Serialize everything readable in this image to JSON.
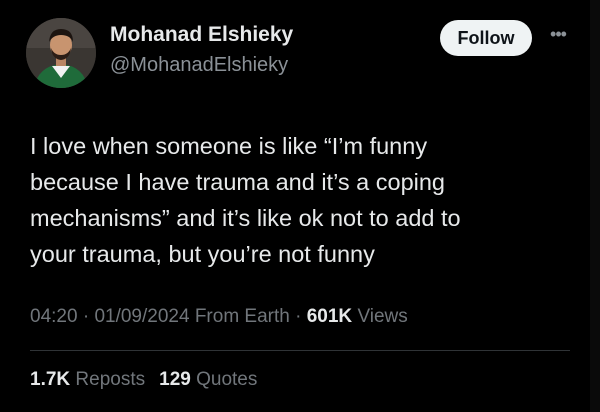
{
  "author": {
    "display_name": "Mohanad Elshieky",
    "handle": "@MohanadElshieky"
  },
  "actions": {
    "follow_label": "Follow",
    "more_icon": "more-horizontal-icon"
  },
  "tweet": {
    "text": "I love when someone is like “I’m funny\nbecause I have trauma and it’s a coping\nmechanisms” and it’s like ok not to add to\nyour trauma, but you’re not funny"
  },
  "meta": {
    "time": "04:20",
    "separator": " · ",
    "date": "01/09/2024",
    "source": "From Earth",
    "views_count": "601K",
    "views_label": "Views"
  },
  "stats": {
    "reposts_count": "1.7K",
    "reposts_label": "Reposts",
    "quotes_count": "129",
    "quotes_label": "Quotes"
  },
  "colors": {
    "background": "#000000",
    "primary_text": "#e7e9ea",
    "secondary_text": "#71767b",
    "follow_bg": "#eff3f4"
  }
}
